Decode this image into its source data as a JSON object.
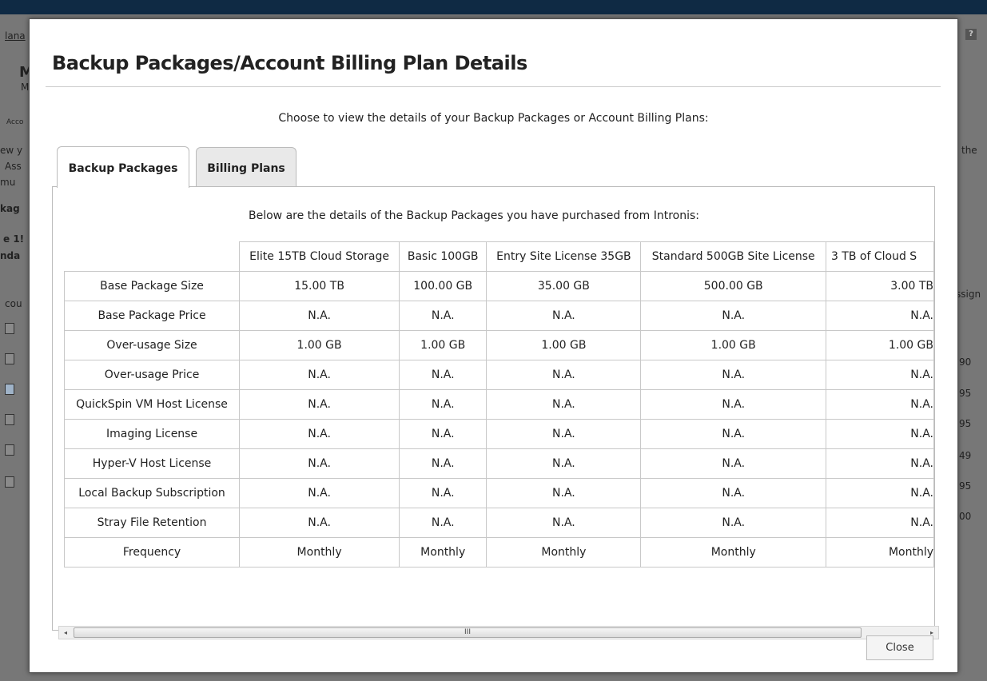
{
  "background": {
    "left_fragments": [
      "lana",
      "M",
      "M",
      "Acco",
      "ew y",
      "Ass",
      "mu",
      "kag",
      "e 1!",
      "nda",
      "cou"
    ],
    "right_fragments": [
      "the",
      "ssign",
      "90",
      "95",
      "95",
      "49",
      "95",
      "00"
    ]
  },
  "modal": {
    "title": "Backup Packages/Account Billing Plan Details",
    "choose_text": "Choose to view the details of your Backup Packages or Account Billing Plans:",
    "tabs": [
      {
        "label": "Backup Packages",
        "active": true
      },
      {
        "label": "Billing Plans",
        "active": false
      }
    ],
    "intro_text": "Below are the details of the Backup Packages you have purchased from Intronis:",
    "table": {
      "columns": [
        "Elite 15TB Cloud Storage",
        "Basic 100GB",
        "Entry Site License 35GB",
        "Standard 500GB Site License",
        "3 TB of Cloud S"
      ],
      "rows": [
        {
          "label": "Base Package Size",
          "values": [
            "15.00 TB",
            "100.00 GB",
            "35.00 GB",
            "500.00 GB",
            "3.00 TB"
          ]
        },
        {
          "label": "Base Package Price",
          "values": [
            "N.A.",
            "N.A.",
            "N.A.",
            "N.A.",
            "N.A."
          ]
        },
        {
          "label": "Over-usage Size",
          "values": [
            "1.00 GB",
            "1.00 GB",
            "1.00 GB",
            "1.00 GB",
            "1.00 GB"
          ]
        },
        {
          "label": "Over-usage Price",
          "values": [
            "N.A.",
            "N.A.",
            "N.A.",
            "N.A.",
            "N.A."
          ]
        },
        {
          "label": "QuickSpin VM Host License",
          "values": [
            "N.A.",
            "N.A.",
            "N.A.",
            "N.A.",
            "N.A."
          ]
        },
        {
          "label": "Imaging License",
          "values": [
            "N.A.",
            "N.A.",
            "N.A.",
            "N.A.",
            "N.A."
          ]
        },
        {
          "label": "Hyper-V Host License",
          "values": [
            "N.A.",
            "N.A.",
            "N.A.",
            "N.A.",
            "N.A."
          ]
        },
        {
          "label": "Local Backup Subscription",
          "values": [
            "N.A.",
            "N.A.",
            "N.A.",
            "N.A.",
            "N.A."
          ]
        },
        {
          "label": "Stray File Retention",
          "values": [
            "N.A.",
            "N.A.",
            "N.A.",
            "N.A.",
            "N.A."
          ]
        },
        {
          "label": "Frequency",
          "values": [
            "Monthly",
            "Monthly",
            "Monthly",
            "Monthly",
            "Monthly"
          ]
        }
      ]
    },
    "scrollbar": {
      "left_arrow": "◂",
      "right_arrow": "▸",
      "thumb_grip": "III"
    },
    "close_label": "Close"
  },
  "colors": {
    "topbar": "#0f2a44",
    "overlay": "#777777",
    "modal_bg": "#ffffff",
    "tab_inactive": "#e9e9e9"
  }
}
